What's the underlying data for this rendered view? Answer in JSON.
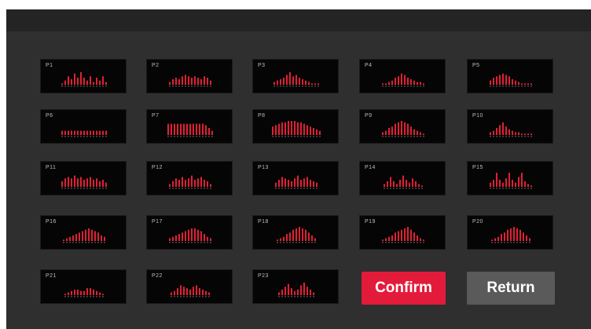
{
  "presets": [
    {
      "label": "P1",
      "bars": [
        0.1,
        0.3,
        0.6,
        0.4,
        0.8,
        0.5,
        0.9,
        0.5,
        0.3,
        0.6,
        0.2,
        0.5,
        0.3,
        0.6,
        0.2
      ]
    },
    {
      "label": "P2",
      "bars": [
        0.2,
        0.4,
        0.5,
        0.4,
        0.6,
        0.7,
        0.6,
        0.5,
        0.6,
        0.5,
        0.4,
        0.6,
        0.5,
        0.3
      ]
    },
    {
      "label": "P3",
      "bars": [
        0.2,
        0.3,
        0.4,
        0.5,
        0.7,
        0.9,
        0.6,
        0.7,
        0.5,
        0.4,
        0.3,
        0.2,
        0.1,
        0.1,
        0.1
      ]
    },
    {
      "label": "P4",
      "bars": [
        0.1,
        0.1,
        0.2,
        0.3,
        0.5,
        0.6,
        0.8,
        0.7,
        0.5,
        0.4,
        0.3,
        0.2,
        0.2,
        0.1
      ]
    },
    {
      "label": "P5",
      "bars": [
        0.3,
        0.5,
        0.6,
        0.7,
        0.8,
        0.7,
        0.6,
        0.4,
        0.3,
        0.2,
        0.1,
        0.1,
        0.1,
        0.1
      ]
    },
    {
      "label": "P6",
      "bars": [
        0.3,
        0.3,
        0.3,
        0.3,
        0.3,
        0.3,
        0.3,
        0.3,
        0.3,
        0.3,
        0.3,
        0.3,
        0.3,
        0.3,
        0.3
      ]
    },
    {
      "label": "P7",
      "bars": [
        0.8,
        0.8,
        0.8,
        0.8,
        0.8,
        0.8,
        0.8,
        0.8,
        0.8,
        0.8,
        0.8,
        0.8,
        0.7,
        0.5,
        0.3
      ]
    },
    {
      "label": "P8",
      "bars": [
        0.6,
        0.7,
        0.8,
        0.9,
        0.9,
        1.0,
        1.0,
        1.0,
        0.9,
        0.9,
        0.8,
        0.7,
        0.6,
        0.5,
        0.4,
        0.3
      ]
    },
    {
      "label": "P9",
      "bars": [
        0.2,
        0.3,
        0.5,
        0.6,
        0.8,
        0.9,
        1.0,
        0.9,
        0.8,
        0.6,
        0.4,
        0.3,
        0.2,
        0.1
      ]
    },
    {
      "label": "P10",
      "bars": [
        0.2,
        0.3,
        0.5,
        0.7,
        0.9,
        0.6,
        0.4,
        0.3,
        0.2,
        0.2,
        0.1,
        0.1,
        0.1,
        0.1
      ]
    },
    {
      "label": "P11",
      "bars": [
        0.4,
        0.6,
        0.7,
        0.6,
        0.8,
        0.6,
        0.7,
        0.5,
        0.6,
        0.7,
        0.5,
        0.6,
        0.4,
        0.5,
        0.3
      ]
    },
    {
      "label": "P12",
      "bars": [
        0.2,
        0.4,
        0.6,
        0.5,
        0.7,
        0.5,
        0.6,
        0.8,
        0.5,
        0.6,
        0.7,
        0.5,
        0.4,
        0.2
      ]
    },
    {
      "label": "P13",
      "bars": [
        0.3,
        0.5,
        0.7,
        0.6,
        0.5,
        0.4,
        0.6,
        0.8,
        0.5,
        0.6,
        0.7,
        0.5,
        0.4,
        0.3
      ]
    },
    {
      "label": "P14",
      "bars": [
        0.2,
        0.4,
        0.7,
        0.4,
        0.2,
        0.5,
        0.8,
        0.5,
        0.3,
        0.6,
        0.4,
        0.2,
        0.1
      ]
    },
    {
      "label": "P15",
      "bars": [
        0.3,
        0.5,
        1.0,
        0.5,
        0.3,
        0.6,
        1.0,
        0.5,
        0.3,
        0.7,
        1.0,
        0.4,
        0.2,
        0.1
      ]
    },
    {
      "label": "P16",
      "bars": [
        0.1,
        0.2,
        0.3,
        0.4,
        0.5,
        0.6,
        0.7,
        0.8,
        0.9,
        0.8,
        0.7,
        0.6,
        0.4,
        0.3
      ]
    },
    {
      "label": "P17",
      "bars": [
        0.2,
        0.3,
        0.4,
        0.5,
        0.6,
        0.7,
        0.8,
        0.9,
        0.9,
        0.8,
        0.7,
        0.5,
        0.3,
        0.2
      ]
    },
    {
      "label": "P18",
      "bars": [
        0.1,
        0.2,
        0.3,
        0.5,
        0.6,
        0.8,
        0.9,
        1.0,
        0.9,
        0.8,
        0.6,
        0.4,
        0.2
      ]
    },
    {
      "label": "P19",
      "bars": [
        0.1,
        0.2,
        0.3,
        0.4,
        0.6,
        0.7,
        0.8,
        0.9,
        1.0,
        0.8,
        0.6,
        0.4,
        0.2,
        0.1
      ]
    },
    {
      "label": "P20",
      "bars": [
        0.1,
        0.2,
        0.3,
        0.5,
        0.6,
        0.8,
        0.9,
        1.0,
        0.9,
        0.8,
        0.6,
        0.4,
        0.2
      ]
    },
    {
      "label": "P21",
      "bars": [
        0.1,
        0.2,
        0.3,
        0.4,
        0.4,
        0.3,
        0.3,
        0.5,
        0.5,
        0.4,
        0.3,
        0.2,
        0.1
      ]
    },
    {
      "label": "P22",
      "bars": [
        0.2,
        0.3,
        0.5,
        0.7,
        0.6,
        0.5,
        0.4,
        0.6,
        0.7,
        0.5,
        0.4,
        0.3,
        0.2
      ]
    },
    {
      "label": "P23",
      "bars": [
        0.2,
        0.4,
        0.6,
        0.8,
        0.5,
        0.3,
        0.4,
        0.7,
        0.9,
        0.6,
        0.4,
        0.2
      ]
    }
  ],
  "buttons": {
    "confirm_label": "Confirm",
    "return_label": "Return"
  },
  "colors": {
    "screen_bg": "#2f2f2f",
    "topbar_bg": "#242424",
    "tile_bg": "#050505",
    "bar_color": "#e02034",
    "confirm_bg": "#e31b3b",
    "return_bg": "#5a5a5a"
  }
}
